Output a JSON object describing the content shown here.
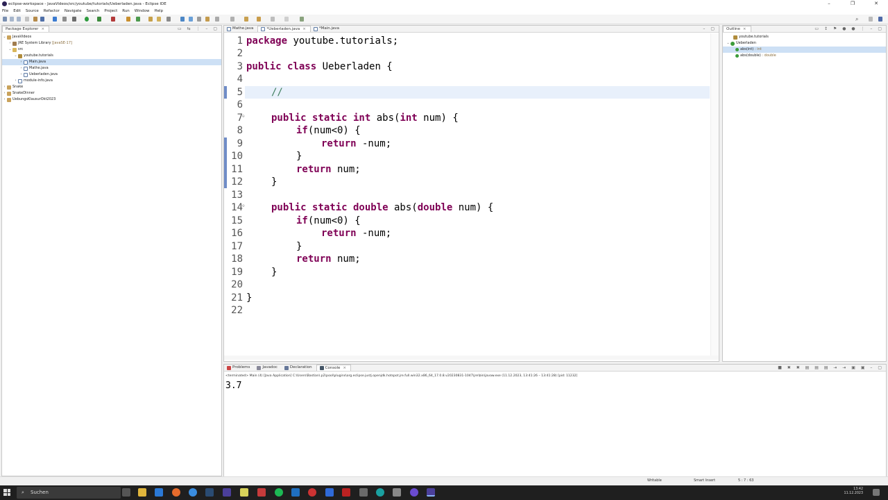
{
  "window": {
    "title": "eclipse-workspace - JavaVideos/src/youtube/tutorials/Ueberladen.java - Eclipse IDE"
  },
  "menu": [
    "File",
    "Edit",
    "Source",
    "Refactor",
    "Navigate",
    "Search",
    "Project",
    "Run",
    "Window",
    "Help"
  ],
  "package_explorer": {
    "tab": "Package Explorer",
    "items": [
      {
        "label": "JavaVideos",
        "deco": ""
      },
      {
        "label": "JRE System Library",
        "deco": "[JavaSE-17]"
      },
      {
        "label": "src",
        "deco": ""
      },
      {
        "label": "youtube.tutorials",
        "deco": ""
      },
      {
        "label": "Main.java",
        "deco": ""
      },
      {
        "label": "Mathe.java",
        "deco": ""
      },
      {
        "label": "Ueberladen.java",
        "deco": ""
      },
      {
        "label": "module-info.java",
        "deco": ""
      },
      {
        "label": "Snake",
        "deco": ""
      },
      {
        "label": "SnakeDinner",
        "deco": ""
      },
      {
        "label": "UebungsKlausurOkt2023",
        "deco": ""
      }
    ]
  },
  "editor": {
    "tabs": [
      "Mathe.java",
      "*Ueberladen.java",
      "*Main.java"
    ],
    "lines": [
      "1",
      "2",
      "3",
      "4",
      "5",
      "6",
      "7",
      "8",
      "9",
      "10",
      "11",
      "12",
      "13",
      "14",
      "15",
      "16",
      "17",
      "18",
      "19",
      "20",
      "21",
      "22"
    ],
    "code": {
      "l1_kw": "package",
      "l1_rest": " youtube.tutorials;",
      "l3_kw": "public class",
      "l3_rest": " Ueberladen {",
      "l5": "//",
      "l7_kw": "public static int",
      "l7_mid": " abs(",
      "l7_kw2": "int",
      "l7_rest": " num) {",
      "l8_kw": "if",
      "l8_rest": "(num<0) {",
      "l9_kw": "return",
      "l9_rest": " -num;",
      "l10": "}",
      "l11_kw": "return",
      "l11_rest": " num;",
      "l12": "}",
      "l14_kw": "public static double",
      "l14_mid": " abs(",
      "l14_kw2": "double",
      "l14_rest": " num) {",
      "l15_kw": "if",
      "l15_rest": "(num<0) {",
      "l16_kw": "return",
      "l16_rest": " -num;",
      "l17": "}",
      "l18_kw": "return",
      "l18_rest": " num;",
      "l19": "}",
      "l21": "}"
    }
  },
  "outline": {
    "tab": "Outline",
    "items": [
      {
        "label": "youtube.tutorials",
        "deco": ""
      },
      {
        "label": "Ueberladen",
        "deco": ""
      },
      {
        "label": "abs(int)",
        "deco": ": int"
      },
      {
        "label": "abs(double)",
        "deco": ": double"
      }
    ]
  },
  "console": {
    "tabs": [
      "Problems",
      "Javadoc",
      "Declaration",
      "Console"
    ],
    "status": "<terminated> Main (4) [Java Application] C:\\Users\\Bastian\\.p2\\pool\\plugins\\org.eclipse.justj.openjdk.hotspot.jre.full.win32.x86_64_17.0.8.v20230831-1047\\jre\\bin\\javaw.exe  (11.12.2023, 13:41:26 – 13:41:28) [pid: 11232]",
    "output": "3.7"
  },
  "statusbar": {
    "mode": "Writable",
    "insert": "Smart Insert",
    "position": "5 : 7 : 63"
  },
  "taskbar": {
    "search": "Suchen",
    "time": "13:42",
    "date": "11.12.2023"
  }
}
